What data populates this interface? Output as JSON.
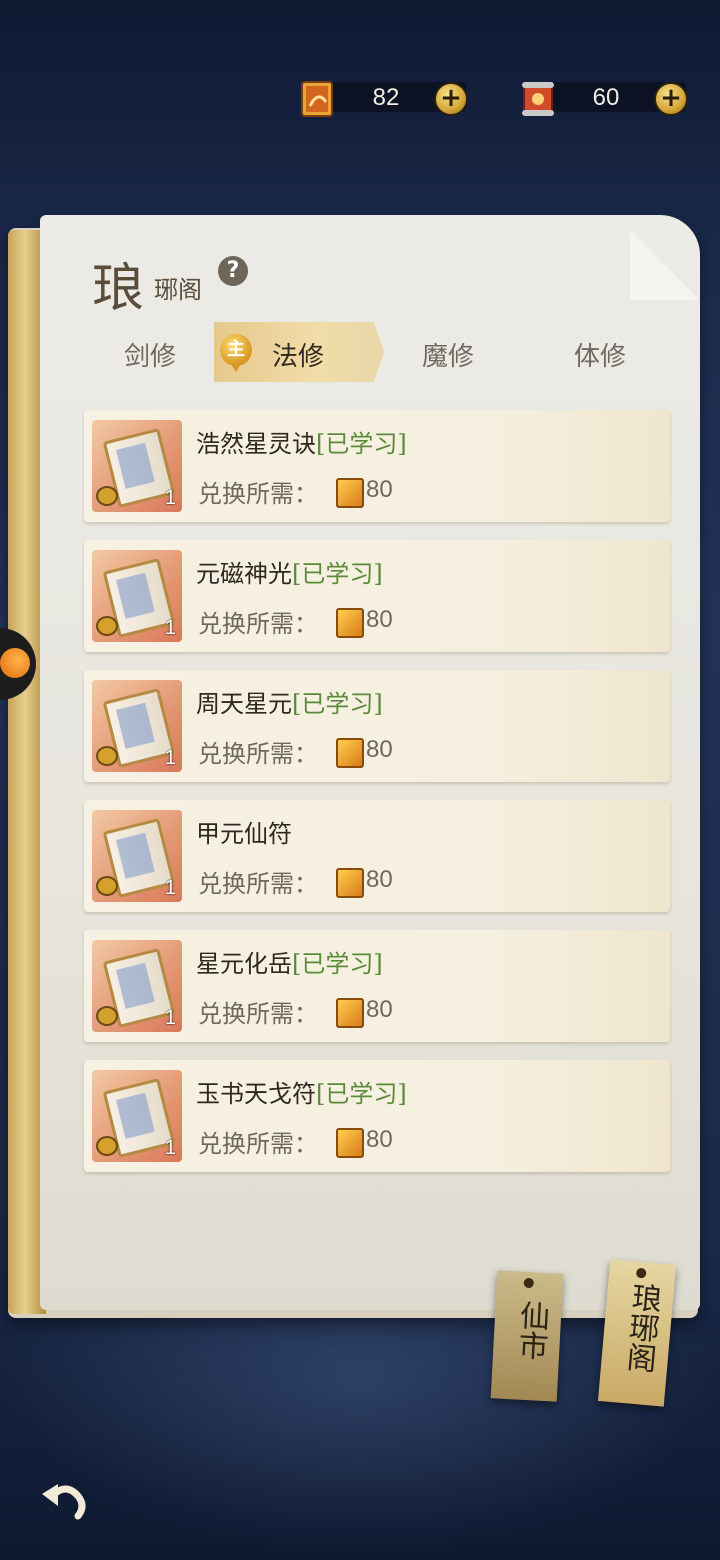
{
  "currency": [
    {
      "icon": "skill-book-icon",
      "value": "82"
    },
    {
      "icon": "scroll-token-icon",
      "value": "60"
    }
  ],
  "header": {
    "title_big": "琅",
    "title_small": "琊阁",
    "help": "?"
  },
  "tabs": [
    {
      "label": "剑修"
    },
    {
      "label": "法修",
      "active": true,
      "badge": "主"
    },
    {
      "label": "魔修"
    },
    {
      "label": "体修"
    }
  ],
  "items": [
    {
      "name": "浩然星灵诀",
      "status": "[已学习]",
      "cost_label": "兑换所需：",
      "cost": "80",
      "count": "1"
    },
    {
      "name": "元磁神光",
      "status": "[已学习]",
      "cost_label": "兑换所需：",
      "cost": "80",
      "count": "1"
    },
    {
      "name": "周天星元",
      "status": "[已学习]",
      "cost_label": "兑换所需：",
      "cost": "80",
      "count": "1"
    },
    {
      "name": "甲元仙符",
      "status": "",
      "cost_label": "兑换所需：",
      "cost": "80",
      "count": "1"
    },
    {
      "name": "星元化岳",
      "status": "[已学习]",
      "cost_label": "兑换所需：",
      "cost": "80",
      "count": "1"
    },
    {
      "name": "玉书天戈符",
      "status": "[已学习]",
      "cost_label": "兑换所需：",
      "cost": "80",
      "count": "1"
    }
  ],
  "side_tabs": [
    {
      "label": "仙市"
    },
    {
      "label": "琅琊阁",
      "active": true
    }
  ],
  "colors": {
    "learned": "#5b8a3a",
    "accent": "#d4a537"
  }
}
